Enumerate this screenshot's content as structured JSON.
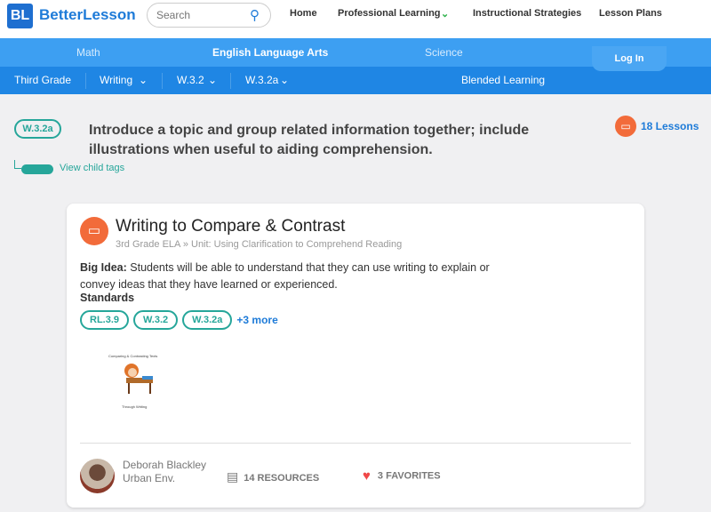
{
  "header": {
    "logo": "BL",
    "brand": "BetterLesson",
    "search_placeholder": "Search",
    "nav": [
      "Home",
      "Professional Learning",
      "Instructional Strategies",
      "Lesson Plans"
    ]
  },
  "subjects": [
    "Math",
    "English Language Arts",
    "Science"
  ],
  "login": "Log In",
  "breadcrumbs": [
    "Third Grade",
    "Writing",
    "W.3.2",
    "W.3.2a"
  ],
  "blended": "Blended Learning",
  "standard": {
    "code": "W.3.2a",
    "description": "Introduce a topic and group related information together; include illustrations when useful to aiding comprehension.",
    "lessons": "18 Lessons",
    "child_tags": "View child tags"
  },
  "lesson": {
    "title": "Writing to Compare & Contrast",
    "subtitle": "3rd Grade ELA » Unit: Using Clarification to Comprehend Reading",
    "big_idea_label": "Big Idea:",
    "big_idea": " Students will be able to understand that they can use writing to explain or convey ideas that they have learned or experienced.",
    "standards_label": "Standards",
    "standards": [
      "RL.3.9",
      "W.3.2",
      "W.3.2a"
    ],
    "more": "+3 more",
    "thumb_title": "Comparing & Contrasting Texts",
    "thumb_caption": "Through Writing",
    "author": "Deborah Blackley",
    "school": "Urban Env.",
    "resources": "14 RESOURCES",
    "favorites": "3 FAVORITES"
  },
  "colors": {
    "primary": "#1f86e4",
    "teal": "#26a69a",
    "orange": "#f26b3a",
    "heart": "#f04848"
  }
}
